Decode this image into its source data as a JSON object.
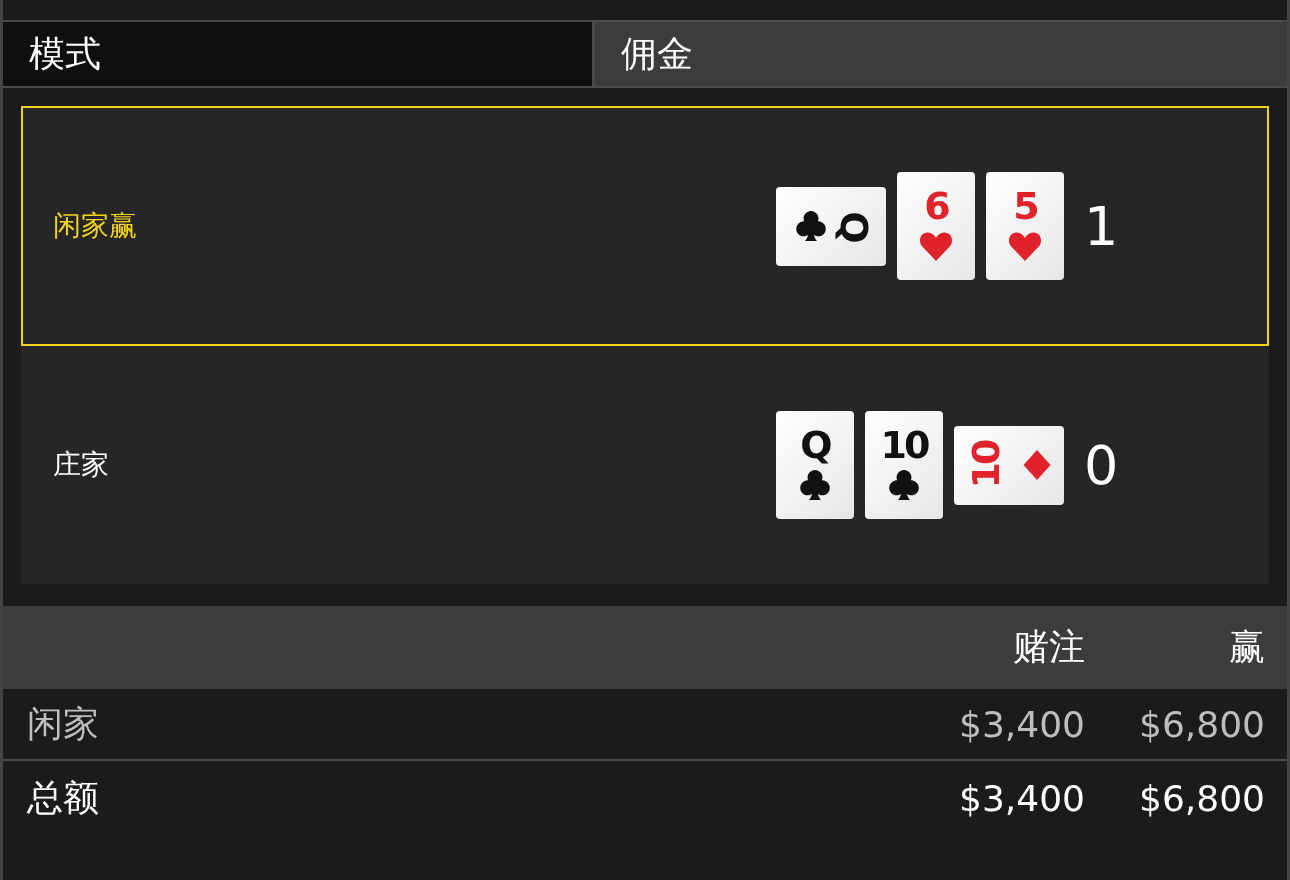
{
  "tabs": [
    {
      "label": "模式",
      "selected": true
    },
    {
      "label": "佣金",
      "selected": false
    }
  ],
  "hands": [
    {
      "label": "闲家赢",
      "winner": true,
      "score": "1",
      "cards": [
        {
          "rank": "Q",
          "kind": "club",
          "sideways": true,
          "reversed": true
        },
        {
          "rank": "6",
          "kind": "heart",
          "sideways": false,
          "reversed": false
        },
        {
          "rank": "5",
          "kind": "heart",
          "sideways": false,
          "reversed": false
        }
      ]
    },
    {
      "label": "庄家",
      "winner": false,
      "score": "0",
      "cards": [
        {
          "rank": "Q",
          "kind": "club",
          "sideways": false,
          "reversed": false
        },
        {
          "rank": "10",
          "kind": "club",
          "sideways": false,
          "reversed": false
        },
        {
          "rank": "10",
          "kind": "diamond",
          "sideways": true,
          "reversed": false
        }
      ]
    }
  ],
  "summary": {
    "columns": [
      "赌注",
      "赢"
    ],
    "rows": [
      {
        "label": "闲家",
        "bet": "$3,400",
        "win": "$6,800",
        "kind": "detail"
      },
      {
        "label": "总额",
        "bet": "$3,400",
        "win": "$6,800",
        "kind": "total"
      }
    ]
  }
}
